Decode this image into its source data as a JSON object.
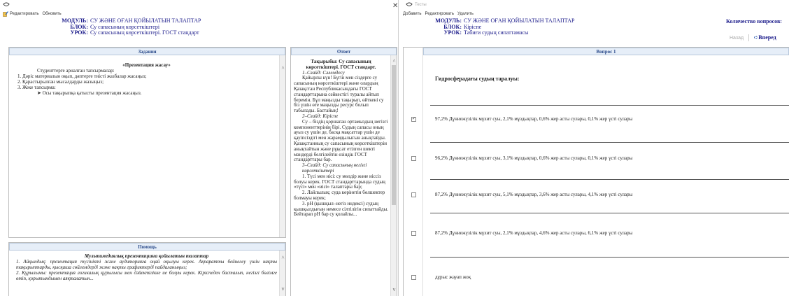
{
  "left": {
    "toolbar": {
      "edit": "Редактировать",
      "refresh": "Обновить"
    },
    "info": {
      "module_label": "МОДУЛЬ:",
      "module": "СУ ЖӘНЕ ОҒАН ҚОЙЫЛАТЫН ТАЛАПТАР",
      "block_label": "БЛОК:",
      "block": "Су сапасының көрсеткіштері",
      "lesson_label": "УРОК:",
      "lesson": "Су сапасының көрсеткіштері. ГОСТ стандарт"
    },
    "tasks": {
      "header": "Задания",
      "title": "«Презентация жасау»",
      "intro": "Студенттерге арналған тапсырмалар:",
      "items": [
        "1. Дәріс материалын оқып, дәптерге тиісті жазбалар жасаңыз;",
        "2. Қарастырылған мысалдарды жазыңыз;",
        "3. Жеке тапсырма:"
      ],
      "bullet": "➤ Осы тақырыпқа қатысты презентация жасаңыз."
    },
    "help": {
      "header": "Помощь",
      "title": "Мультимедиялық презентацияға қойылатын талаптар",
      "p1": "1. Айқындық: презентация түсінікті және аудиторияға оңай оқылуы керек. Ақпаратты бейнелеу үшін нақты тақырыптарды, қысқаша сөйлемдерді және нақты графиктерді пайдаланыңыз;",
      "p2": "2. Құрылымы: презентация логикалық құрылысы мен дәйектілікке ие болуы керек. Кіріспеден басталып, негізгі бөлімге өтіп, қорытындымен аяқталатын..."
    },
    "answer": {
      "header": "Ответ",
      "title": "Тақырыбы: Су сапасының көрсеткіштері. ГОСТ стандарт.",
      "s1": "1–Слайд: Сәлемдесу",
      "s1t": "Қайырлы күн! Бүгін мен сіздерге су сапасының көрсеткіштері және олардың Қазақстан Республикасындағы ГОСТ стандарттарына сәйкестігі туралы айтып беремін. Бұл маңызды тақырып, өйткені су біз үшін өте маңызды ресурс болып табылады. Бастайық!",
      "s2": "2–Слайд: Кіріспе",
      "s2t": "Су – біздің қоршаған ортамыздың негізгі компоненттерінің бірі. Судың сапасы оның ауыз су үшін де, басқа мақсаттар үшін де қауіпсіздігі мен жарамдылығын анықтайды. Қазақстанның су сапасының көрсеткіштерін анықтайтын және рұқсат етілген шекті мәндерді белгілейтін өзіндік ГОСТ стандарттары бар.",
      "s3": "3–Слайд: Су сапасының негізгі көрсеткіштері",
      "s3t1": "1. Түсі мен иісі: су мөлдір және иіссіз болуы керек. ГОСТ стандарттарында судың «түсі» мен «иісі» талаптары бар;",
      "s3t2": "2. Лайлылық: суда көрінетін бөлшектер болмауы керек;",
      "s3t3": "3. pH (қышқыл–негіз индексі) судың қышқылдығын немесе сілтілігін сипаттайды. Бейтарап pH бар су қолайлы..."
    }
  },
  "right": {
    "title": "Тесты",
    "toolbar": {
      "add": "Добавить",
      "edit": "Редактировать",
      "delete": "Удалить"
    },
    "info": {
      "module_label": "МОДУЛЬ:",
      "module": "СУ ЖӘНЕ ОҒАН ҚОЙЫЛАТЫН ТАЛАПТАР",
      "block_label": "БЛОК:",
      "block": "Кіріспе",
      "lesson_label": "УРОК:",
      "lesson": "Табиғи судың сипаттамасы"
    },
    "count_label": "Количество вопросов:",
    "nav": {
      "back": "Назад",
      "forward": "Вперед"
    },
    "question_header": "Вопрос 1",
    "question": "Гидросферадағы судың таралуы:",
    "options": [
      {
        "text": "97,2% Дүниежүзілік мұхит суы, 2,1% мұздықтар, 0,6% жер асты сулары, 0,1% жер үсті сулары",
        "checked": true
      },
      {
        "text": "96,2% Дүниежүзілік мұхит суы, 3,1% мұздықтар, 0,6% жер асты сулары, 0,1% жер үсті сулары",
        "checked": false
      },
      {
        "text": "87,2% Дүниежүзілік мұхит суы, 5,1% мұздықтар, 3,6% жер асты сулары, 4,1% жер үсті сулары",
        "checked": false
      },
      {
        "text": "87,2% Дүниежүзілік мұхит суы, 2,1% мұздықтар, 4,6% жер асты сулары, 6,1% жер үсті сулары",
        "checked": false
      },
      {
        "text": "дұрыс жауап жоқ",
        "checked": false
      }
    ]
  }
}
